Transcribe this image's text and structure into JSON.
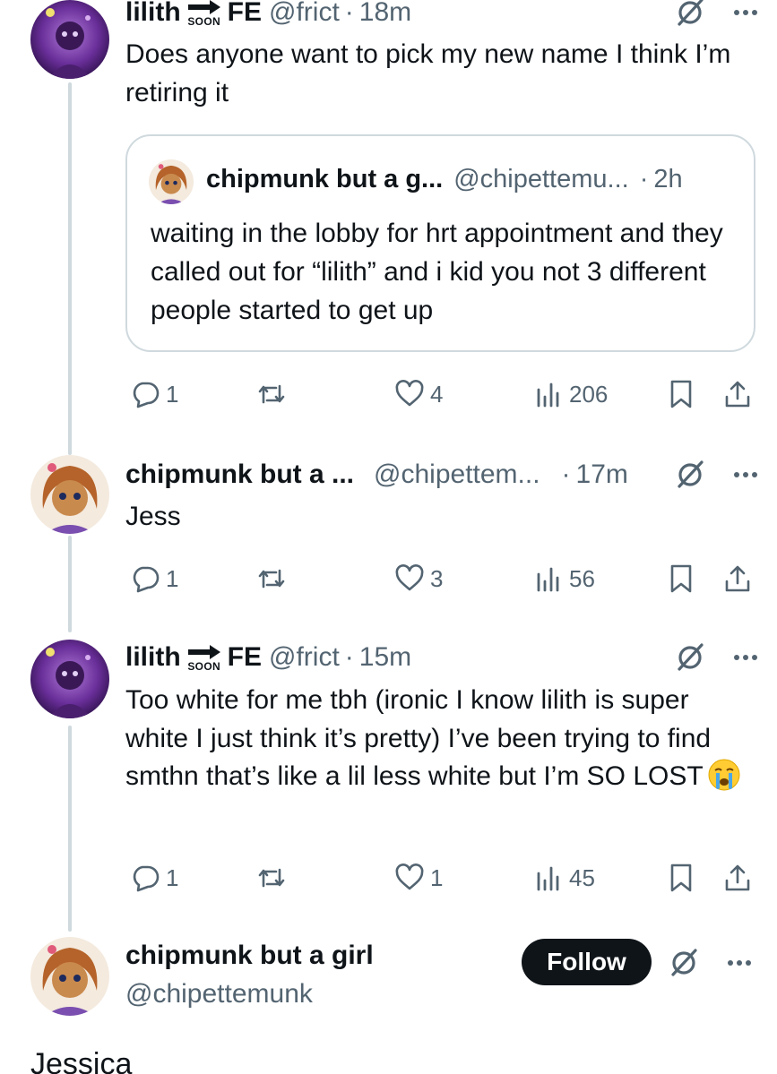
{
  "tweets": [
    {
      "display_name": "lilith",
      "display_name_suffix": "FE",
      "badge": "SOON",
      "handle": "@frict",
      "time": "18m",
      "text": "Does anyone want to pick my new name I think I’m retiring it",
      "quote": {
        "display_name": "chipmunk but a g...",
        "handle": "@chipettemu...",
        "time": "2h",
        "text": "waiting in the lobby for hrt appointment and they called out for “lilith” and i kid you not 3 different people started to get up"
      },
      "replies": "1",
      "likes": "4",
      "views": "206"
    },
    {
      "display_name": "chipmunk but a ...",
      "handle": "@chipettem...",
      "time": "17m",
      "text": "Jess",
      "replies": "1",
      "likes": "3",
      "views": "56"
    },
    {
      "display_name": "lilith",
      "display_name_suffix": "FE",
      "badge": "SOON",
      "handle": "@frict",
      "time": "15m",
      "text": "Too white for me tbh (ironic I know lilith is super white I just think it’s pretty) I’ve been trying to find smthn that’s like a lil less white but I’m SO LOST",
      "emoji": "loudly-crying-face",
      "replies": "1",
      "likes": "1",
      "views": "45"
    }
  ],
  "main_tweet": {
    "display_name": "chipmunk but a girl",
    "handle": "@chipettemunk",
    "follow_label": "Follow",
    "text": "Jessica"
  },
  "colors": {
    "text": "#0f1419",
    "secondary": "#536471",
    "border": "#cfd9de",
    "follow_bg": "#0f1419"
  }
}
